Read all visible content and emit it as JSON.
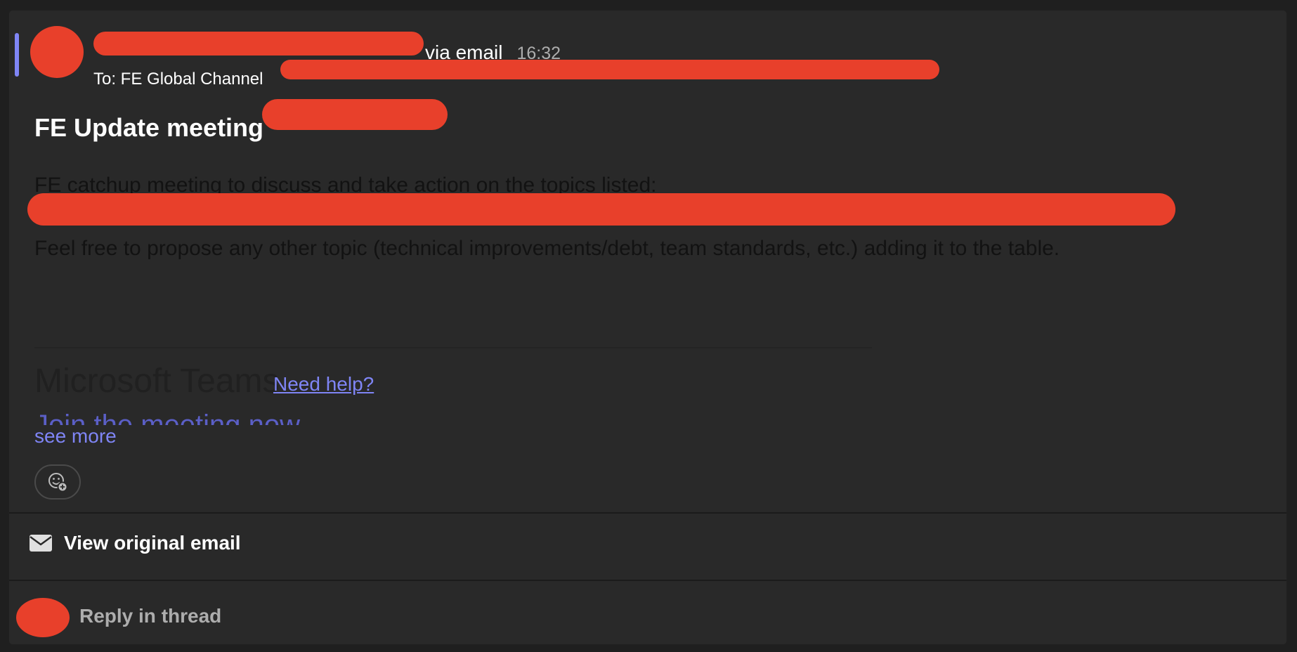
{
  "message": {
    "via_label": "via email",
    "time": "16:32",
    "to_line": "To: FE Global Channel",
    "subject": "FE Update meeting",
    "body": {
      "line1": "FE catchup meeting to discuss and take action on the topics listed:",
      "line3": "Feel free to propose any other topic (technical improvements/debt, team standards, etc.) adding it to the table."
    },
    "teams_block": {
      "title": "Microsoft Teams",
      "need_help": "Need help?",
      "join": "Join the meeting now"
    },
    "see_more": "see more"
  },
  "actions": {
    "view_original_email": "View original email",
    "reply_in_thread": "Reply in thread"
  },
  "colors": {
    "accent": "#7f85f5",
    "link": "#7f85f5",
    "redaction": "#e8402b",
    "card_background": "#292929"
  },
  "icons": {
    "reaction": "add-reaction-icon",
    "email": "envelope-icon"
  }
}
